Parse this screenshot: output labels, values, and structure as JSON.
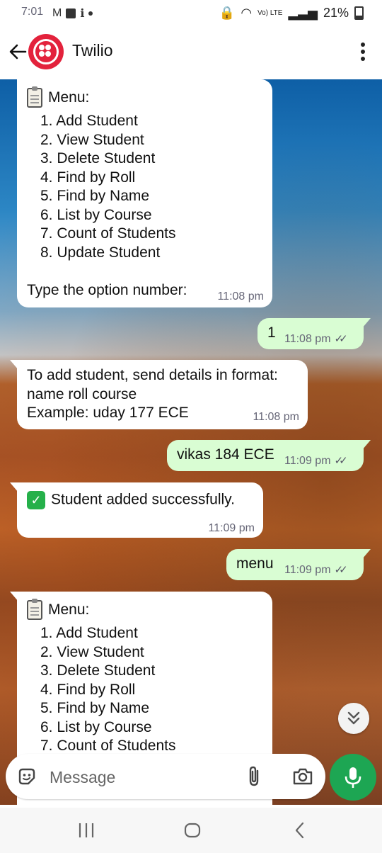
{
  "status_bar": {
    "time": "7:01",
    "left_glyphs": "M",
    "volte": "Vo) LTE",
    "battery": "21%"
  },
  "header": {
    "title": "Twilio"
  },
  "messages": [
    {
      "type": "incoming",
      "menu_title": "Menu:",
      "items": [
        "1. Add Student",
        "2. View Student",
        "3. Delete Student",
        "4. Find by Roll",
        "5. Find by Name",
        "6. List by Course",
        "7. Count of Students",
        "8. Update Student"
      ],
      "footer": "Type the option number:",
      "time": "11:08 pm"
    },
    {
      "type": "outgoing",
      "text": "1",
      "time": "11:08 pm"
    },
    {
      "type": "incoming",
      "lines": [
        "To add student, send details in format:",
        "name roll course",
        "Example: uday 177 ECE"
      ],
      "time": "11:08 pm"
    },
    {
      "type": "outgoing",
      "text": "vikas 184 ECE",
      "time": "11:09 pm"
    },
    {
      "type": "incoming",
      "text": "Student added successfully.",
      "time": "11:09 pm"
    },
    {
      "type": "outgoing",
      "text": "menu",
      "time": "11:09 pm"
    },
    {
      "type": "incoming",
      "menu_title": "Menu:",
      "items": [
        "1. Add Student",
        "2. View Student",
        "3. Delete Student",
        "4. Find by Roll",
        "5. Find by Name",
        "6. List by Course",
        "7. Count of Students"
      ]
    }
  ],
  "input": {
    "placeholder": "Message"
  },
  "colors": {
    "outgoing_bubble": "#d9fdd3",
    "mic_button": "#1da653",
    "brand": "#e3223c"
  }
}
